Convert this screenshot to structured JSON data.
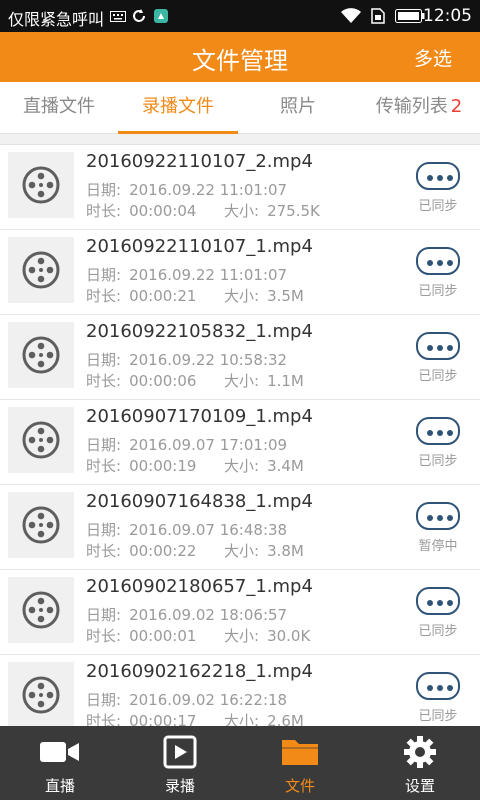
{
  "status_bar": {
    "carrier": "仅限紧急呼叫",
    "time": "12:05",
    "icons": [
      "keyboard-icon",
      "sync-icon",
      "app-icon",
      "wifi-icon",
      "sim-icon",
      "battery-icon"
    ]
  },
  "header": {
    "title": "文件管理",
    "multi_select": "多选"
  },
  "tabs": {
    "items": [
      {
        "label": "直播文件"
      },
      {
        "label": "录播文件"
      },
      {
        "label": "照片"
      },
      {
        "label": "传输列表",
        "badge": "2"
      }
    ],
    "active": "录播文件"
  },
  "files": {
    "date_label": "日期:",
    "duration_label": "时长:",
    "size_label": "大小:",
    "items": [
      {
        "name": "20160922110107_2.mp4",
        "date": "2016.09.22 11:01:07",
        "duration": "00:00:04",
        "size": "275.5K",
        "status": "已同步"
      },
      {
        "name": "20160922110107_1.mp4",
        "date": "2016.09.22 11:01:07",
        "duration": "00:00:21",
        "size": "3.5M",
        "status": "已同步"
      },
      {
        "name": "20160922105832_1.mp4",
        "date": "2016.09.22 10:58:32",
        "duration": "00:00:06",
        "size": "1.1M",
        "status": "已同步"
      },
      {
        "name": "20160907170109_1.mp4",
        "date": "2016.09.07 17:01:09",
        "duration": "00:00:19",
        "size": "3.4M",
        "status": "已同步"
      },
      {
        "name": "20160907164838_1.mp4",
        "date": "2016.09.07 16:48:38",
        "duration": "00:00:22",
        "size": "3.8M",
        "status": "暂停中"
      },
      {
        "name": "20160902180657_1.mp4",
        "date": "2016.09.02 18:06:57",
        "duration": "00:00:01",
        "size": "30.0K",
        "status": "已同步"
      },
      {
        "name": "20160902162218_1.mp4",
        "date": "2016.09.02 16:22:18",
        "duration": "00:00:17",
        "size": "2.6M",
        "status": "已同步"
      }
    ]
  },
  "bottom_nav": {
    "items": [
      {
        "label": "直播",
        "icon": "video-camera-icon"
      },
      {
        "label": "录播",
        "icon": "play-box-icon"
      },
      {
        "label": "文件",
        "icon": "folder-icon"
      },
      {
        "label": "设置",
        "icon": "gear-icon"
      }
    ],
    "active": "文件"
  },
  "colors": {
    "accent": "#f28a18",
    "badge": "#f03c32",
    "more_button": "#2f5478",
    "nav_background": "#3a3a3a"
  }
}
